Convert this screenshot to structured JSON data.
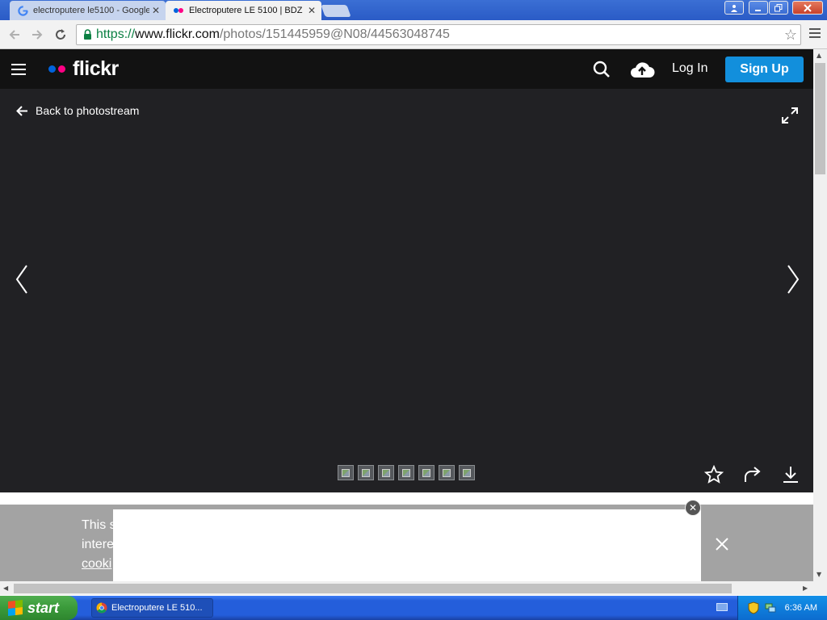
{
  "browser": {
    "tabs": [
      {
        "title": "electroputere le5100 - Google",
        "active": false,
        "icon": "google-favicon"
      },
      {
        "title": "Electroputere LE 5100 | BDZ",
        "active": true,
        "icon": "flickr-favicon"
      }
    ],
    "url": {
      "scheme": "https://",
      "host": "www.flickr.com",
      "path": "/photos/151445959@N08/44563048745"
    }
  },
  "flickr": {
    "logo_text": "flickr",
    "login_label": "Log In",
    "signup_label": "Sign Up",
    "back_label": "Back to photostream",
    "thumbnail_count": 7,
    "colors": {
      "pink": "#ff0084",
      "blue": "#0063dc",
      "signup": "#128fdc",
      "stage": "#212124"
    }
  },
  "cookie_banner": {
    "lines": [
      "This s",
      "intere",
      "cooki"
    ]
  },
  "taskbar": {
    "start_label": "start",
    "window_title": "Electroputere LE 510...",
    "clock": "6:36 AM"
  }
}
